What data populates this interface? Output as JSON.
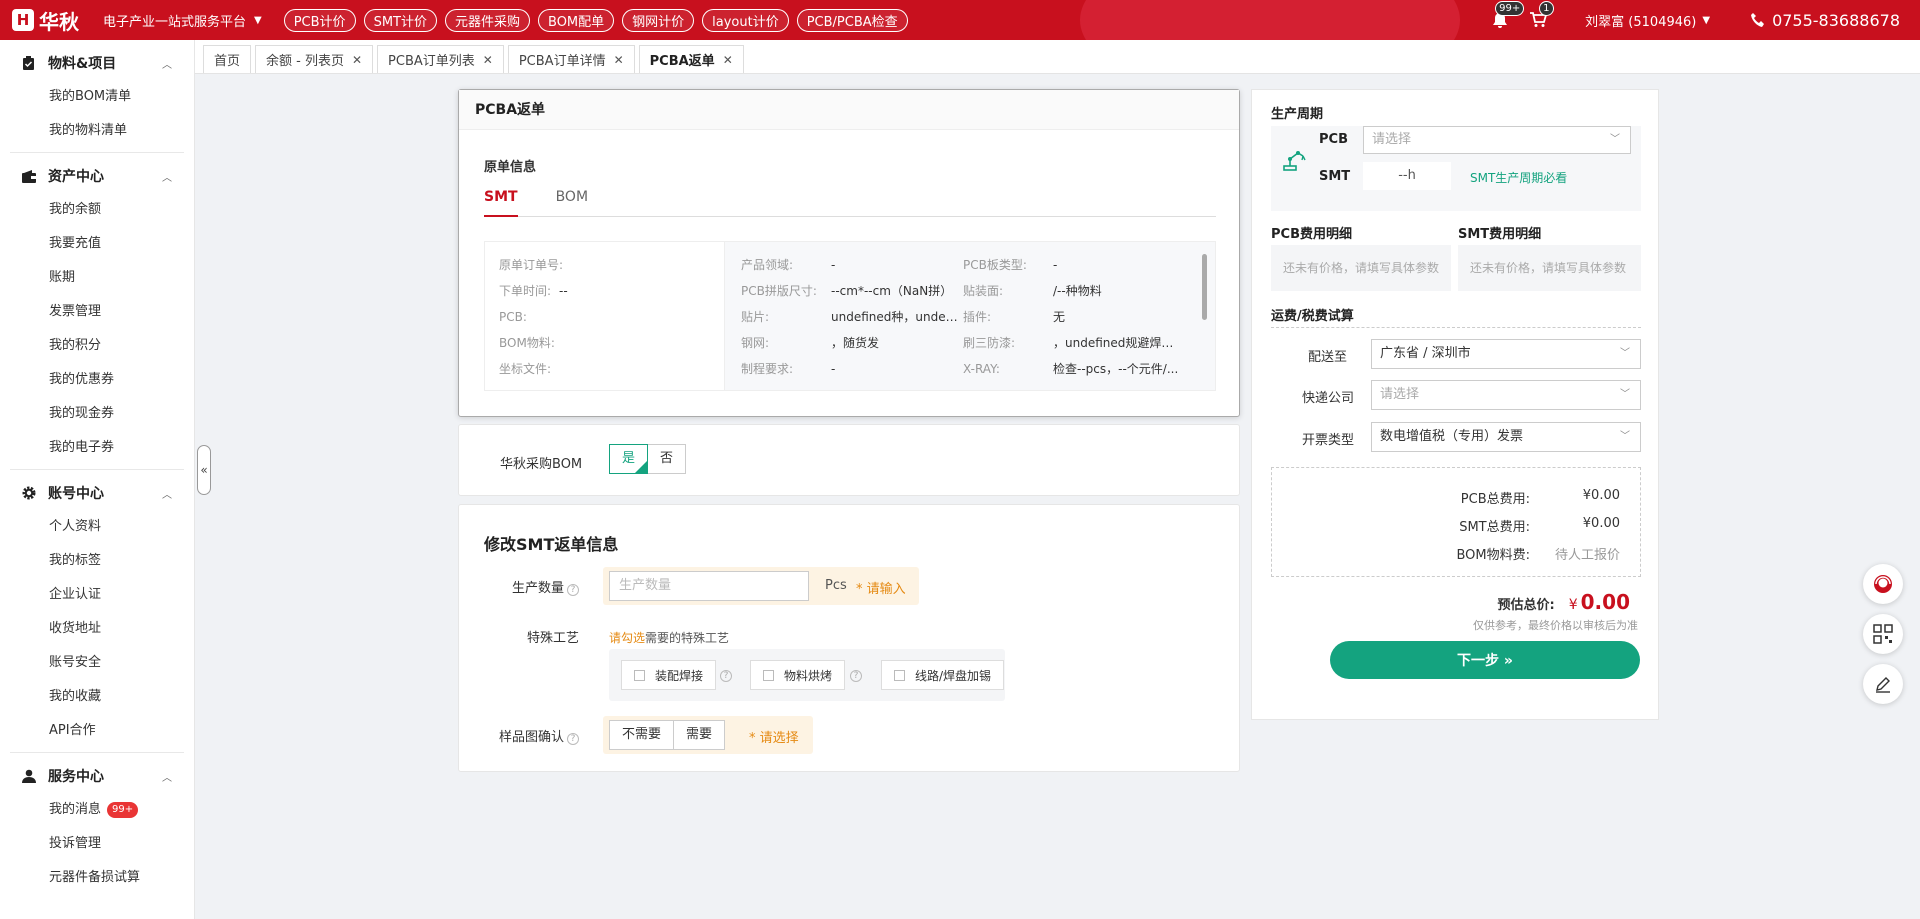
{
  "topbar": {
    "logo_mark": "H",
    "logo_text": "华秋",
    "platform": "电子产业一站式服务平台",
    "nav": [
      "PCB计价",
      "SMT计价",
      "元器件采购",
      "BOM配单",
      "钢网计价",
      "layout计价",
      "PCB/PCBA检查"
    ],
    "bell_badge": "99+",
    "cart_badge": "1",
    "user": "刘翠富 (5104946)",
    "phone": "0755-83688678"
  },
  "sidebar": {
    "groups": [
      {
        "title": "物料&项目",
        "icon": "clipboard-icon",
        "items": [
          "我的BOM清单",
          "我的物料清单"
        ]
      },
      {
        "title": "资产中心",
        "icon": "wallet-icon",
        "items": [
          "我的余额",
          "我要充值",
          "账期",
          "发票管理",
          "我的积分",
          "我的优惠券",
          "我的现金券",
          "我的电子券"
        ]
      },
      {
        "title": "账号中心",
        "icon": "gear-icon",
        "items": [
          "个人资料",
          "我的标签",
          "企业认证",
          "收货地址",
          "账号安全",
          "我的收藏",
          "API合作"
        ]
      },
      {
        "title": "服务中心",
        "icon": "user-icon",
        "items": [
          "我的消息",
          "投诉管理",
          "元器件备损试算"
        ],
        "msg_badge": "99+"
      }
    ]
  },
  "tabs": [
    {
      "label": "首页",
      "close": false
    },
    {
      "label": "余额 - 列表页",
      "close": true
    },
    {
      "label": "PCBA订单列表",
      "close": true
    },
    {
      "label": "PCBA订单详情",
      "close": true
    },
    {
      "label": "PCBA返单",
      "close": true,
      "active": true
    }
  ],
  "main": {
    "card_title": "PCBA返单",
    "section_title": "原单信息",
    "subtabs": [
      "SMT",
      "BOM"
    ],
    "left_info": [
      {
        "label": "原单订单号:",
        "value": ""
      },
      {
        "label": "下单时间:",
        "value": "--"
      },
      {
        "label": "PCB:",
        "value": ""
      },
      {
        "label": "BOM物料:",
        "value": ""
      },
      {
        "label": "坐标文件:",
        "value": ""
      }
    ],
    "right_info": [
      [
        "产品领域:",
        "-",
        "PCB板类型:",
        "-"
      ],
      [
        "PCB拼版尺寸:",
        "--cm*--cm（NaN拼）",
        "贴装面:",
        "/--种物料"
      ],
      [
        "贴片:",
        "undefined种，undefi...",
        "插件:",
        "无"
      ],
      [
        "钢网:",
        "，随货发",
        "刷三防漆:",
        "，undefined规避焊点..."
      ],
      [
        "制程要求:",
        "-",
        "X-RAY:",
        "检查--pcs，--个元件/..."
      ]
    ],
    "bom_label": "华秋采购BOM",
    "yes": "是",
    "no": "否",
    "modify_title": "修改SMT返单信息",
    "qty_label": "生产数量",
    "qty_placeholder": "生产数量",
    "qty_unit": "Pcs",
    "qty_req": "* 请输入",
    "craft_label": "特殊工艺",
    "craft_hint_a": "请勾选",
    "craft_hint_b": "需要的特殊工艺",
    "crafts": [
      "装配焊接",
      "物料烘烤",
      "线路/焊盘加锡"
    ],
    "sample_label": "样品图确认",
    "sample_opts": [
      "不需要",
      "需要"
    ],
    "sample_req": "* 请选择"
  },
  "right": {
    "cycle_title": "生产周期",
    "pcb_label": "PCB",
    "pcb_placeholder": "请选择",
    "smt_label": "SMT",
    "smt_value": "--h",
    "smt_note": "SMT生产周期必看",
    "pcb_fee_title": "PCB费用明细",
    "smt_fee_title": "SMT费用明细",
    "no_price": "还未有价格，请填写具体参数",
    "ship_title": "运费/税费试算",
    "ship_to_label": "配送至",
    "ship_to": "广东省 / 深圳市",
    "courier_label": "快递公司",
    "courier_placeholder": "请选择",
    "invoice_label": "开票类型",
    "invoice": "数电增值税（专用）发票",
    "costs": [
      {
        "label": "PCB总费用:",
        "value": "¥0.00"
      },
      {
        "label": "SMT总费用:",
        "value": "¥0.00"
      },
      {
        "label": "BOM物料费:",
        "value": "待人工报价"
      }
    ],
    "total_label": "预估总价:",
    "total_symbol": "¥",
    "total_value": "0.00",
    "note": "仅供参考，最终价格以审核后为准",
    "next": "下一步 »"
  },
  "colors": {
    "brand": "#c8101e",
    "accent": "#14a37f",
    "warn": "#e58a13"
  }
}
